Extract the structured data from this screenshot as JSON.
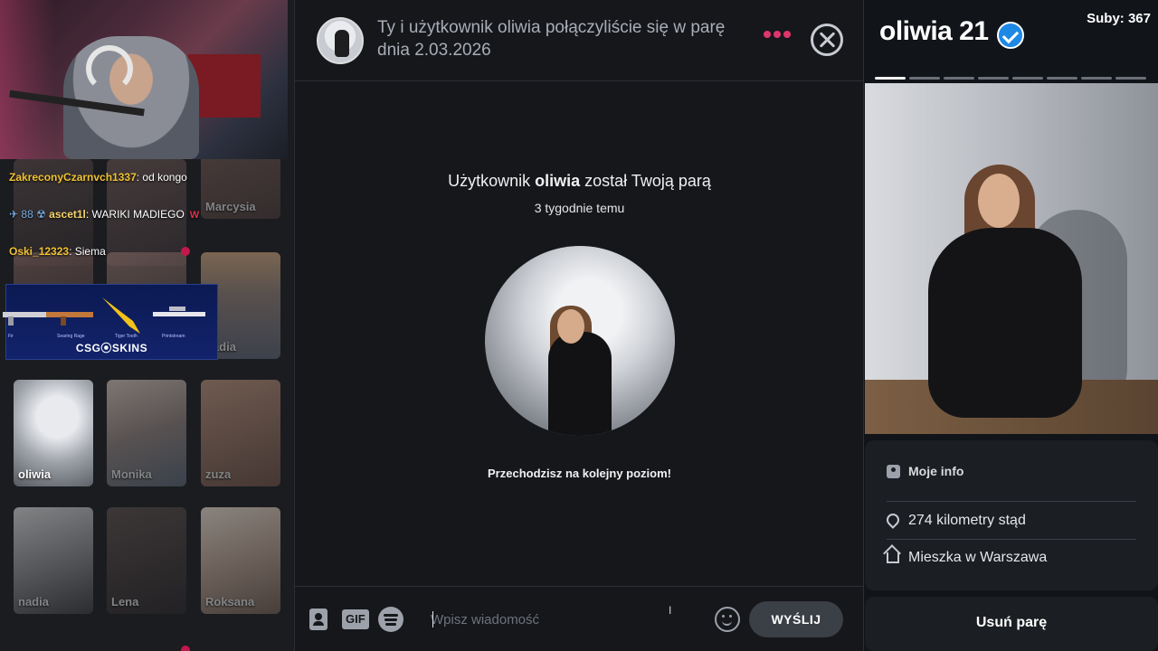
{
  "left": {
    "chat": [
      {
        "user": "ZakreconyCzarnvch1337",
        "text": "od kongo"
      },
      {
        "badges": "✈ 88 ☢",
        "user": "ascet1l",
        "text": "WARIKI MADIEGO",
        "tag": "W"
      },
      {
        "user": "Oski_12323",
        "text": "Siema"
      }
    ],
    "ad": {
      "caption": "CSG⦿SKINS",
      "labels": [
        "Fir",
        "Searing Rage",
        "Tiger Tooth",
        "Printstream"
      ]
    },
    "cards": [
      {
        "name": ""
      },
      {
        "name": ""
      },
      {
        "name": "Marcysia"
      },
      {
        "name": ""
      },
      {
        "name": ""
      },
      {
        "name": "nadia"
      },
      {
        "name": "oliwia"
      },
      {
        "name": "Monika"
      },
      {
        "name": "zuza"
      },
      {
        "name": "nadia"
      },
      {
        "name": "Lena"
      },
      {
        "name": "Roksana"
      }
    ]
  },
  "chat_window": {
    "header_text": "Ty i użytkownik oliwia połączyliście się w parę dnia 2.03.2026",
    "match_prefix": "Użytkownik ",
    "match_user": "oliwia",
    "match_suffix": " został Twoją parą",
    "match_time": "3 tygodnie temu",
    "level_text": "Przechodzisz na kolejny poziom!",
    "composer": {
      "gif_label": "GIF",
      "placeholder": "Wpisz wiadomość",
      "send_label": "WYŚLIJ"
    },
    "accent_color": "#e0356b"
  },
  "profile": {
    "name_age": "oliwia 21",
    "subs": "Suby: 367",
    "photo_count": 8,
    "photo_active_index": 0,
    "info_title": "Moje info",
    "distance": "274 kilometry stąd",
    "location": "Mieszka w Warszawa",
    "remove_label": "Usuń parę"
  }
}
